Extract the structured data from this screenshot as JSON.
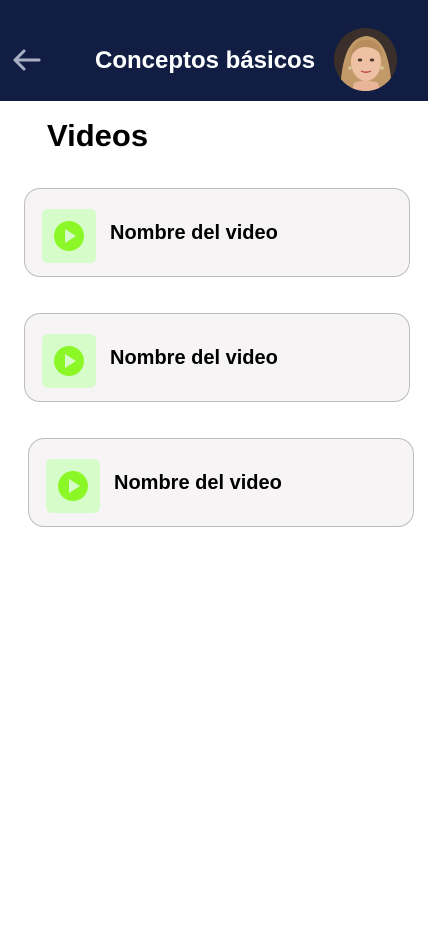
{
  "header": {
    "title": "Conceptos básicos",
    "back_icon": "arrow-left-icon",
    "background_color": "#121d44"
  },
  "section": {
    "title": "Videos"
  },
  "videos": [
    {
      "label": "Nombre del video",
      "icon": "play-icon"
    },
    {
      "label": "Nombre del video",
      "icon": "play-icon"
    },
    {
      "label": "Nombre del video",
      "icon": "play-icon"
    }
  ],
  "colors": {
    "accent_play": "#8cf726",
    "thumb_bg": "#d6fdc9",
    "card_bg": "#f6f4f5"
  }
}
